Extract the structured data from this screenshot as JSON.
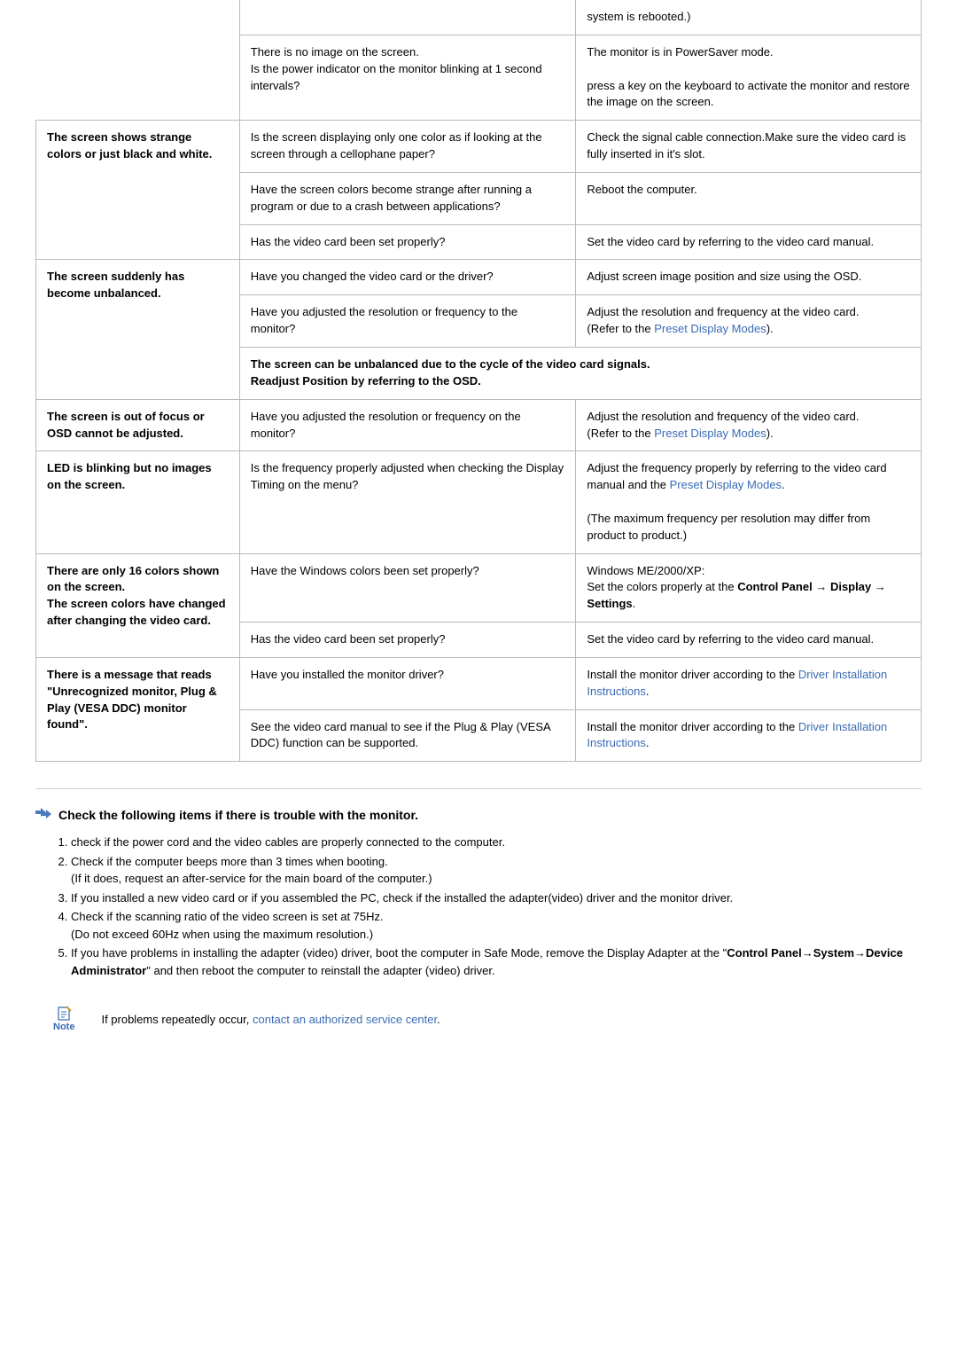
{
  "table": {
    "row0": {
      "remedy": "system is rebooted.)"
    },
    "row1": {
      "check_l1": "There is no image on the screen.",
      "check_l2": "Is the power indicator on the monitor blinking at 1 second intervals?",
      "remedy_l1": "The monitor is in PowerSaver mode.",
      "remedy_l2": "press a key on the keyboard to activate the monitor and restore the image on the screen."
    },
    "row2": {
      "symptom": "The screen shows strange colors or just black and white.",
      "check": "Is the screen displaying only one color as if looking at the screen through a cellophane paper?",
      "remedy": "Check the signal cable connection.Make sure the video card is fully inserted in it's slot."
    },
    "row3": {
      "check": "Have the screen colors become strange after running a program or due to a crash between applications?",
      "remedy": "Reboot the computer."
    },
    "row4": {
      "check": "Has the video card been set properly?",
      "remedy": "Set the video card by referring to the video card manual."
    },
    "row5": {
      "symptom": "The screen suddenly has become unbalanced.",
      "check": "Have you changed the video card or the driver?",
      "remedy": "Adjust screen image position and size using the OSD."
    },
    "row6": {
      "check": "Have you adjusted the resolution or frequency to the monitor?",
      "remedy_l1": "Adjust the resolution and frequency at the video card.",
      "remedy_l2a": "(Refer to the ",
      "remedy_link": "Preset Display Modes",
      "remedy_l2b": ")."
    },
    "row7": {
      "full_l1": "The screen can be unbalanced due to the cycle of the video card signals.",
      "full_l2": "Readjust Position by referring to the OSD."
    },
    "row8": {
      "symptom": "The screen is out of focus or OSD cannot be adjusted.",
      "check": "Have you adjusted the resolution or frequency on the monitor?",
      "remedy_l1": "Adjust the resolution and frequency of the video card.",
      "remedy_l2a": "(Refer to the ",
      "remedy_link": "Preset Display Modes",
      "remedy_l2b": ")."
    },
    "row9": {
      "symptom": "LED is blinking but no images on the screen.",
      "check": "Is the frequency properly adjusted when checking the Display Timing on the menu?",
      "remedy_l1": "Adjust the frequency properly by referring to the video card manual and the ",
      "remedy_link": "Preset Display Modes",
      "remedy_l1b": ".",
      "remedy_l2": "(The maximum frequency per resolution may differ from product to product.)"
    },
    "row10": {
      "symptom_l1": "There are only 16 colors shown on the screen.",
      "symptom_l2": "The screen colors have changed after changing the video card.",
      "check": "Have the Windows colors been set properly?",
      "remedy_l1": "Windows ME/2000/XP:",
      "remedy_l2a": "Set the colors properly at the ",
      "remedy_l2b": "Control Panel",
      "remedy_l2c": "Display",
      "remedy_l2d": "Settings",
      "remedy_l2e": "."
    },
    "row11": {
      "check": "Has the video card been set properly?",
      "remedy": "Set the video card by referring to the video card manual."
    },
    "row12": {
      "symptom": "There is a message that reads \"Unrecognized monitor, Plug & Play (VESA DDC) monitor found\".",
      "check": "Have you installed the monitor driver?",
      "remedy_l1": "Install the monitor driver according to the ",
      "remedy_link": "Driver Installation Instructions",
      "remedy_l1b": "."
    },
    "row13": {
      "check": "See the video card manual to see if the Plug & Play (VESA DDC) function can be supported.",
      "remedy_l1": "Install the monitor driver according to the ",
      "remedy_link": "Driver Installation Instructions",
      "remedy_l1b": "."
    }
  },
  "checklist": {
    "heading": "Check the following items if there is trouble with the monitor.",
    "items": {
      "i1": "check if the power cord and the video cables are properly connected to the computer.",
      "i2a": "Check if the computer beeps more than 3 times when booting.",
      "i2b": "(If it does, request an after-service for the main board of the computer.)",
      "i3": "If you installed a new video card or if you assembled the PC, check if the installed the adapter(video) driver and the monitor driver.",
      "i4a": "Check if the scanning ratio of the video screen is set at 75Hz.",
      "i4b": "(Do not exceed 60Hz when using the maximum resolution.)",
      "i5a": "If you have problems in installing the adapter (video) driver, boot the computer in Safe Mode, remove the Display Adapter at the \"",
      "i5b": "Control Panel",
      "i5c": "System",
      "i5d": "Device Administrator",
      "i5e": "\" and then reboot the computer to reinstall the adapter (video) driver."
    }
  },
  "note": {
    "label": "Note",
    "text_a": "If problems repeatedly occur, ",
    "link": "contact an authorized service center",
    "text_b": "."
  }
}
